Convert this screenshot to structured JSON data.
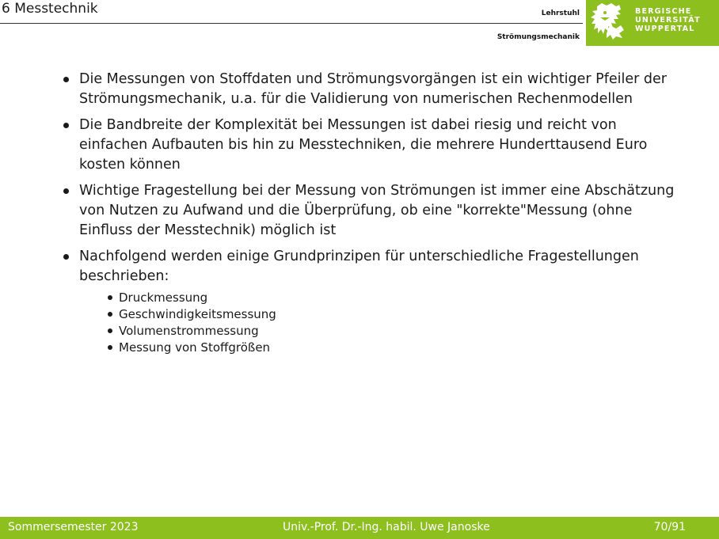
{
  "header": {
    "section_title": "6 Messtechnik",
    "chair_line1": "Lehrstuhl",
    "chair_line2": "Strömungsmechanik",
    "university": {
      "line1": "BERGISCHE",
      "line2": "UNIVERSITÄT",
      "line3": "WUPPERTAL"
    },
    "logo_icon": "lion-icon",
    "brand_color": "#8dbf1f"
  },
  "bullets": [
    "Die Messungen von Stoffdaten und Strömungsvorgängen ist ein wichtiger Pfeiler der Strömungsmechanik, u.a. für die Validierung von numerischen Rechenmodellen",
    "Die Bandbreite der Komplexität bei Messungen ist dabei riesig und reicht von einfachen Aufbauten bis hin zu Messtechniken, die mehrere Hunderttausend Euro kosten können",
    "Wichtige Fragestellung bei der Messung von Strömungen ist immer eine Abschätzung von Nutzen zu Aufwand und die Überprüfung, ob eine \"korrekte\"Messung (ohne Einfluss der Messtechnik) möglich ist",
    "Nachfolgend werden einige Grundprinzipen für unterschiedliche Fragestellungen beschrieben:"
  ],
  "sub_bullets": [
    "Druckmessung",
    "Geschwindigkeitsmessung",
    "Volumenstrommessung",
    "Messung von Stoffgrößen"
  ],
  "footer": {
    "semester": "Sommersemester 2023",
    "author": "Univ.-Prof. Dr.-Ing. habil. Uwe Janoske",
    "page": "70/91"
  }
}
